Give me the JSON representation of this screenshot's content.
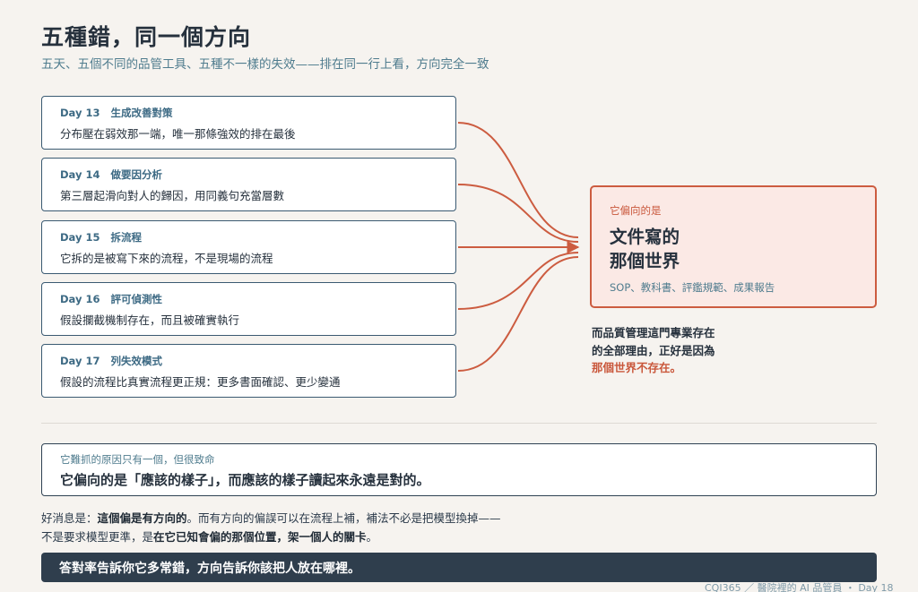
{
  "header": {
    "title": "五種錯，同一個方向",
    "subtitle": "五天、五個不同的品管工具、五種不一樣的失效——排在同一行上看，方向完全一致"
  },
  "cards": [
    {
      "day": "Day 13",
      "tool": "生成改善對策",
      "text": "分布壓在弱效那一端，唯一那條強效的排在最後"
    },
    {
      "day": "Day 14",
      "tool": "做要因分析",
      "text": "第三層起滑向對人的歸因，用同義句充當層數"
    },
    {
      "day": "Day 15",
      "tool": "拆流程",
      "text": "它拆的是被寫下來的流程，不是現場的流程"
    },
    {
      "day": "Day 16",
      "tool": "評可偵測性",
      "text": "假設攔截機制存在，而且被確實執行"
    },
    {
      "day": "Day 17",
      "tool": "列失效模式",
      "text": "假設的流程比真實流程更正規：更多書面確認、更少變通"
    }
  ],
  "target": {
    "kicker": "它偏向的是",
    "line1": "文件寫的",
    "line2": "那個世界",
    "examples": "SOP、教科書、評鑑規範、成果報告"
  },
  "note": {
    "line1": "而品質管理這門專業存在",
    "line2": "的全部理由，正好是因為",
    "line3": "那個世界不存在。"
  },
  "callout": {
    "small": "它難抓的原因只有一個，但很致命",
    "main": "它偏向的是「應該的樣子」，而應該的樣子讀起來永遠是對的。"
  },
  "paragraph": {
    "p1a": "好消息是：",
    "p1b": "這個偏是有方向的",
    "p1c": "。而有方向的偏誤可以在流程上補，補法不必是把模型換掉——",
    "p2a": "不是要求模型更準，是",
    "p2b": "在它已知會偏的那個位置，架一個人的關卡",
    "p2c": "。"
  },
  "banner": "答對率告訴你它多常錯，方向告訴你該把人放在哪裡。",
  "footer": "CQI365 ／ 醫院裡的 AI 品管員 ・ Day 18",
  "colors": {
    "accent": "#cc5c40",
    "navy": "#2f3e4d",
    "card_border": "#3a5a72",
    "subtitle": "#4f7c8e"
  }
}
